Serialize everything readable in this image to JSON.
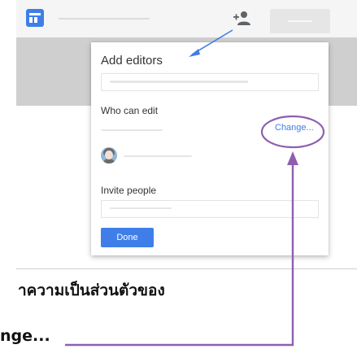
{
  "dialog": {
    "title": "Add editors",
    "who_can_edit_label": "Who can edit",
    "change_link": "Change...",
    "invite_label": "Invite people",
    "done_button": "Done"
  },
  "caption": {
    "line1": "าความเป็นส่วนตัวของ",
    "line2": "nge..."
  },
  "edge_glyphs": {
    "glyph1": "ู",
    "glyph2": "ู้"
  },
  "icons": {
    "app_logo": "forms-logo-icon",
    "add_person": "person-add-icon",
    "avatar": "user-avatar-icon"
  },
  "colors": {
    "accent": "#3f7ee8",
    "annotation": "#8e5fb0",
    "arrow": "#3f7ee8"
  }
}
